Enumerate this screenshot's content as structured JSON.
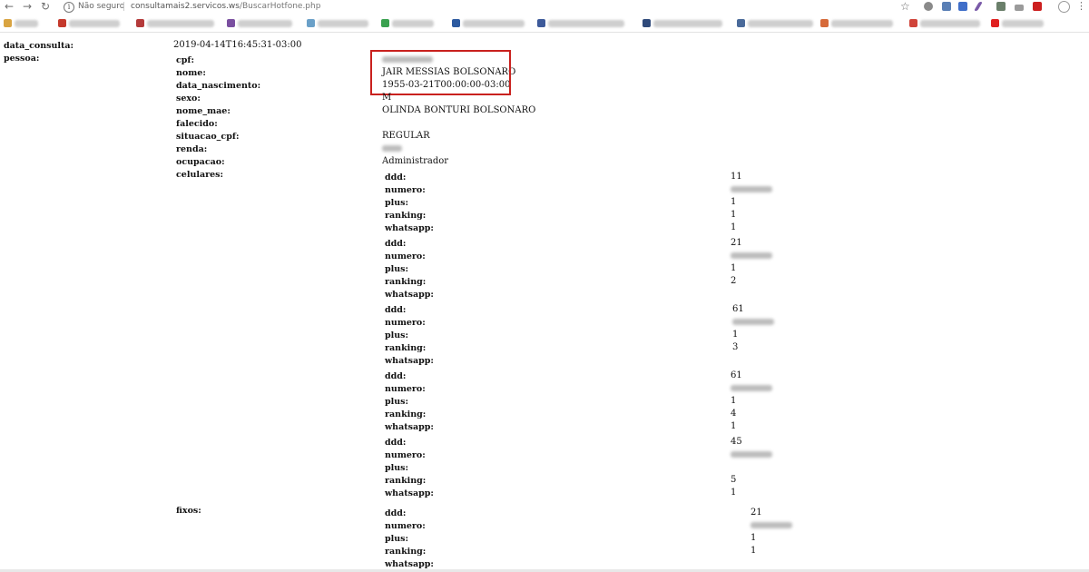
{
  "browser": {
    "security_label": "Não seguro",
    "url_host": "consultamais2.servicos.ws",
    "url_path": "/BuscarHotfone.php"
  },
  "record": {
    "data_consulta": {
      "key": "data_consulta:",
      "value": "2019-04-14T16:45:31-03:00"
    },
    "pessoa": {
      "key": "pessoa:",
      "cpf": {
        "key": "cpf:"
      },
      "nome": {
        "key": "nome:",
        "value": "JAIR MESSIAS BOLSONARO"
      },
      "data_nascimento": {
        "key": "data_nascimento:",
        "value": "1955-03-21T00:00:00-03:00"
      },
      "sexo": {
        "key": "sexo:",
        "value": "M"
      },
      "nome_mae": {
        "key": "nome_mae:",
        "value": "OLINDA BONTURI BOLSONARO"
      },
      "falecido": {
        "key": "falecido:"
      },
      "situacao_cpf": {
        "key": "situacao_cpf:",
        "value": "REGULAR"
      },
      "renda": {
        "key": "renda:"
      },
      "ocupacao": {
        "key": "ocupacao:",
        "value": "Administrador"
      }
    },
    "labels": {
      "celulares": "celulares:",
      "fixos": "fixos:",
      "ddd": "ddd:",
      "numero": "numero:",
      "plus": "plus:",
      "ranking": "ranking:",
      "whatsapp": "whatsapp:"
    },
    "celulares": [
      {
        "ddd": "11",
        "plus": "1",
        "ranking": "1",
        "whatsapp": "1"
      },
      {
        "ddd": "21",
        "plus": "1",
        "ranking": "2",
        "whatsapp": ""
      },
      {
        "ddd": "61",
        "plus": "1",
        "ranking": "3",
        "whatsapp": ""
      },
      {
        "ddd": "61",
        "plus": "1",
        "ranking": "4",
        "whatsapp": "1"
      },
      {
        "ddd": "45",
        "plus": "",
        "ranking": "5",
        "whatsapp": "1"
      }
    ],
    "fixos": [
      {
        "ddd": "21",
        "plus": "1",
        "ranking": "1",
        "whatsapp": ""
      }
    ]
  },
  "colors": {
    "highlight": "#c9211e"
  },
  "icons": [
    "back-arrow-icon",
    "forward-arrow-icon",
    "reload-icon",
    "info-icon",
    "star-icon",
    "menu-icon"
  ]
}
